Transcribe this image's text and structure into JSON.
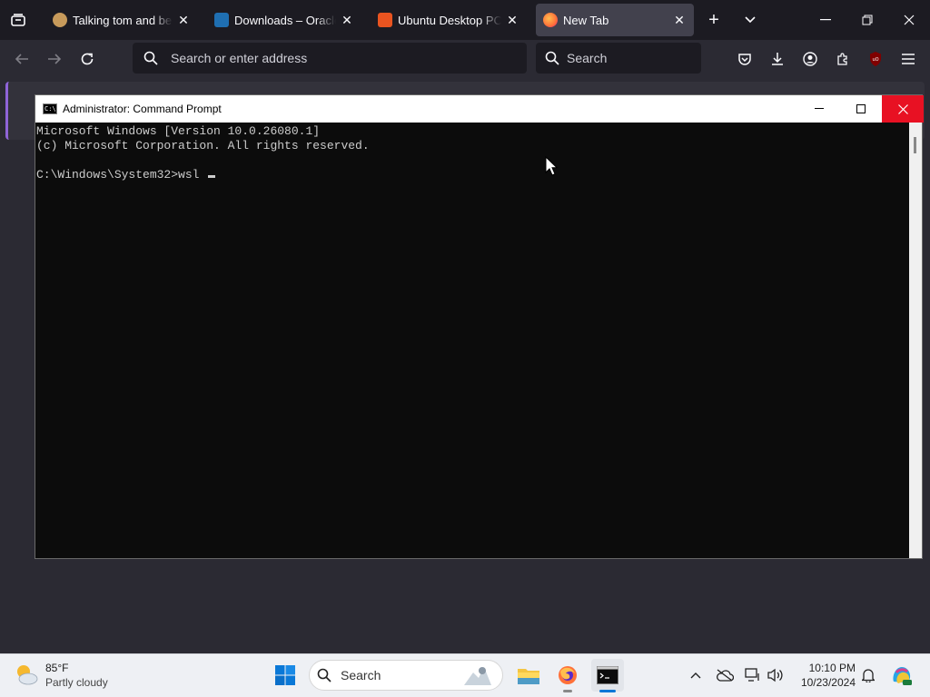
{
  "browser": {
    "tabs": [
      {
        "label": "Talking tom and ben news",
        "favicon_color": "#c79a5b"
      },
      {
        "label": "Downloads – Oracle VirtualBox",
        "favicon_color": "#1f6fb2"
      },
      {
        "label": "Ubuntu Desktop PC operating system",
        "favicon_color": "#e95420"
      },
      {
        "label": "New Tab",
        "favicon_color": "#ff7139"
      }
    ],
    "address_placeholder": "Search or enter address",
    "search_placeholder": "Search",
    "accent_color": "#8f64d8"
  },
  "cmd": {
    "title": "Administrator: Command Prompt",
    "lines": [
      "Microsoft Windows [Version 10.0.26080.1]",
      "(c) Microsoft Corporation. All rights reserved.",
      "",
      "C:\\Windows\\System32>wsl "
    ]
  },
  "taskbar": {
    "weather_temp": "85°F",
    "weather_desc": "Partly cloudy",
    "search_placeholder": "Search",
    "time": "10:10 PM",
    "date": "10/23/2024"
  }
}
